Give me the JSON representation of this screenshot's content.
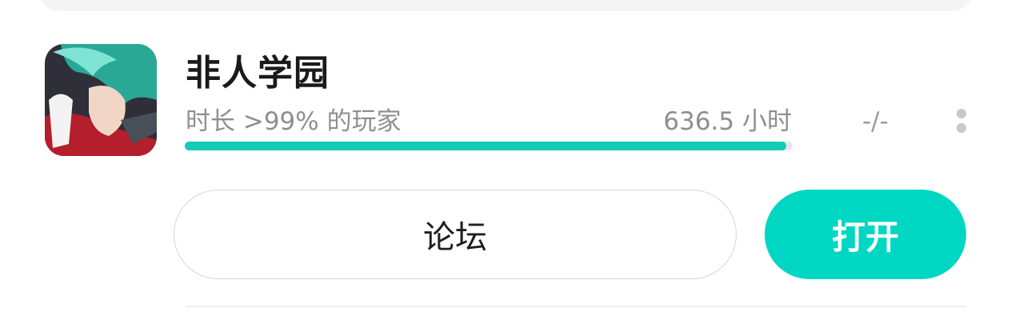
{
  "game": {
    "title": "非人学园",
    "icon": "app-icon-anime-character",
    "playtime_label": "时长 >99% 的玩家",
    "playtime_hours": "636.5 小时",
    "playtime_percentile": 0.99,
    "achievement": "-/-"
  },
  "actions": {
    "forum_label": "论坛",
    "open_label": "打开"
  },
  "colors": {
    "accent": "#00d7c2",
    "progress": "#17c9b6",
    "muted_text": "#8f8f8f"
  }
}
